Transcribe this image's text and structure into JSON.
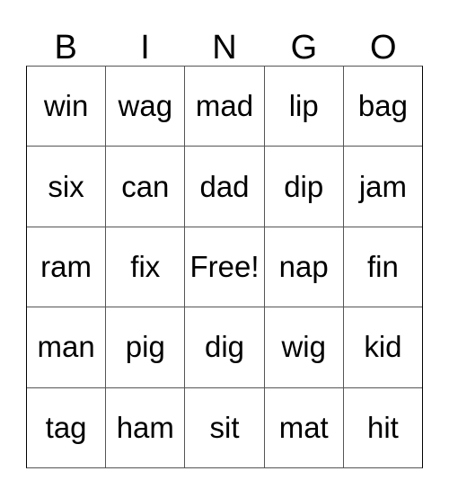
{
  "card": {
    "headers": [
      "B",
      "I",
      "N",
      "G",
      "O"
    ],
    "rows": [
      [
        "win",
        "wag",
        "mad",
        "lip",
        "bag"
      ],
      [
        "six",
        "can",
        "dad",
        "dip",
        "jam"
      ],
      [
        "ram",
        "fix",
        "Free!",
        "nap",
        "fin"
      ],
      [
        "man",
        "pig",
        "dig",
        "wig",
        "kid"
      ],
      [
        "tag",
        "ham",
        "sit",
        "mat",
        "hit"
      ]
    ],
    "free_space": {
      "row": 2,
      "col": 2,
      "label": "Free!"
    },
    "colors": {
      "background": "#ffffff",
      "text": "#000000",
      "grid_line": "#555555",
      "outer_border": "#000000"
    }
  }
}
